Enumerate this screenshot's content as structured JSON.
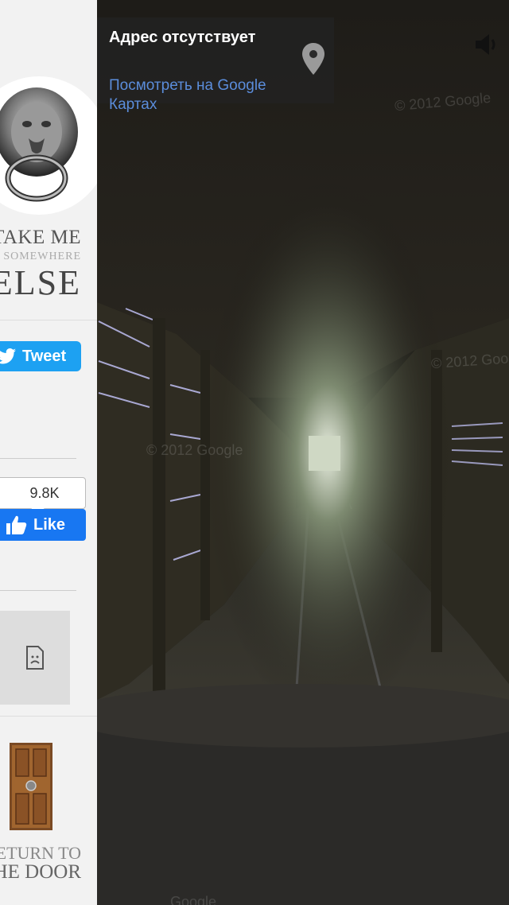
{
  "sidebar": {
    "tagline": {
      "line1": "TAKE ME",
      "line2": "SOMEWHERE",
      "line3": "ELSE"
    },
    "tweet": {
      "label": "Tweet"
    },
    "facebook": {
      "count": "9.8K",
      "label": "Like"
    },
    "return": {
      "line1": "RETURN TO",
      "line2": "THE DOOR"
    }
  },
  "streetview": {
    "address_title": "Адрес отсутствует",
    "maps_link": "Посмотреть на Google Картах",
    "watermark": "© 2012 Google",
    "watermark_partial": "Google"
  },
  "colors": {
    "twitter": "#1da1f2",
    "facebook": "#1877f2",
    "link": "#5b8ddb"
  },
  "icons": [
    "lion-door-knocker-logo",
    "twitter-bird-icon",
    "thumbs-up-icon",
    "broken-file-icon",
    "wooden-door-icon",
    "map-pin-icon",
    "speaker-icon"
  ]
}
